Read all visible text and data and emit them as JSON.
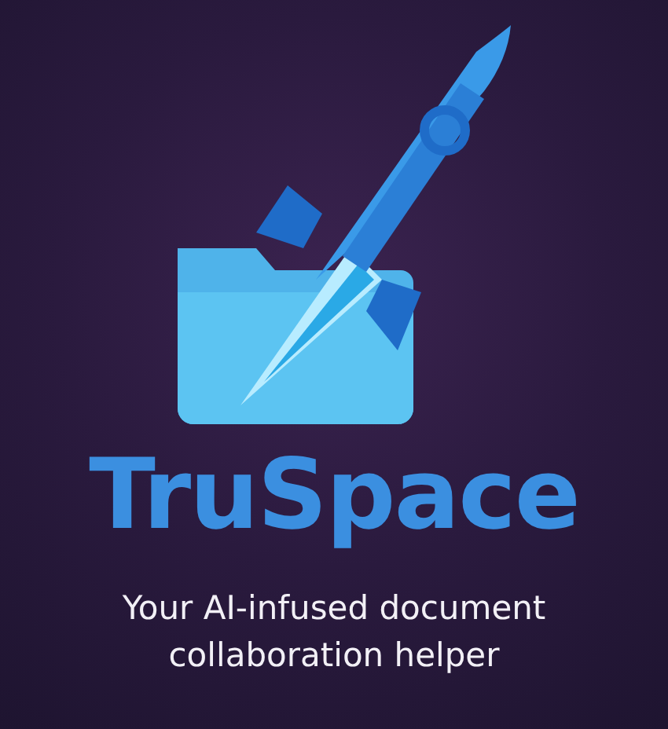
{
  "title": "TruSpace",
  "tagline": [
    "Your AI-infused document",
    "collaboration helper"
  ]
}
